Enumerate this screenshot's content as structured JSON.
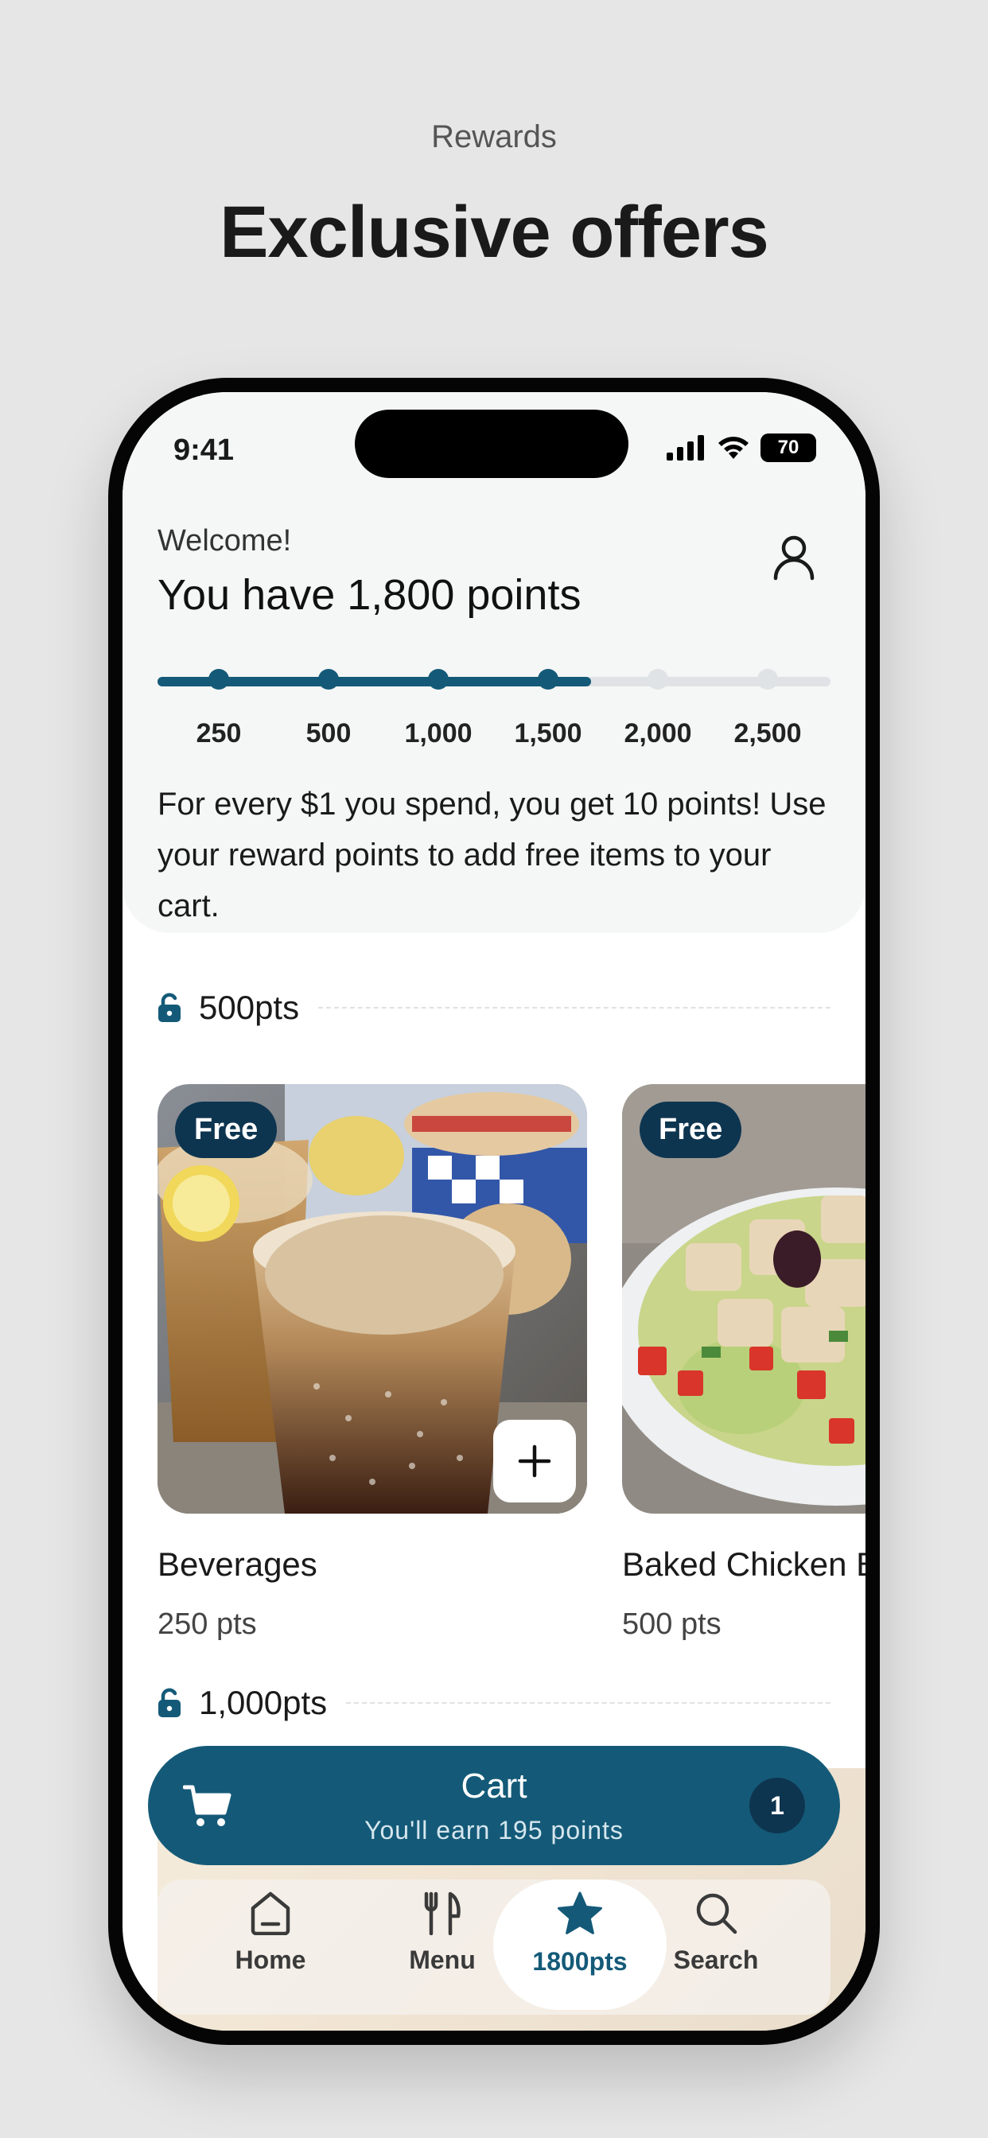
{
  "hero": {
    "subtitle": "Rewards",
    "title": "Exclusive offers"
  },
  "status_bar": {
    "time": "9:41",
    "battery": "70"
  },
  "header": {
    "welcome": "Welcome!",
    "points_title": "You have 1,800 points",
    "progress": {
      "current_points": 1800,
      "ticks": [
        "250",
        "500",
        "1,000",
        "1,500",
        "2,000",
        "2,500"
      ]
    },
    "earn_text": "For every $1 you spend, you get 10 points! Use your reward points to add free items to your cart."
  },
  "sections": [
    {
      "label": "500pts",
      "items": [
        {
          "badge": "Free",
          "name": "Beverages",
          "points": "250 pts"
        },
        {
          "badge": "Free",
          "name": "Baked Chicken B",
          "points": "500 pts"
        }
      ]
    },
    {
      "label": "1,000pts"
    }
  ],
  "cart": {
    "label": "Cart",
    "earn": "You'll earn 195 points",
    "count": "1"
  },
  "nav": {
    "items": [
      {
        "label": "Home",
        "icon": "home-icon"
      },
      {
        "label": "Menu",
        "icon": "utensils-icon"
      },
      {
        "label": "1800pts",
        "icon": "star-icon"
      },
      {
        "label": "Search",
        "icon": "search-icon"
      }
    ],
    "active_index": 2
  },
  "colors": {
    "accent": "#145a78",
    "badge": "#0e3550",
    "background": "#e6e6e6"
  }
}
